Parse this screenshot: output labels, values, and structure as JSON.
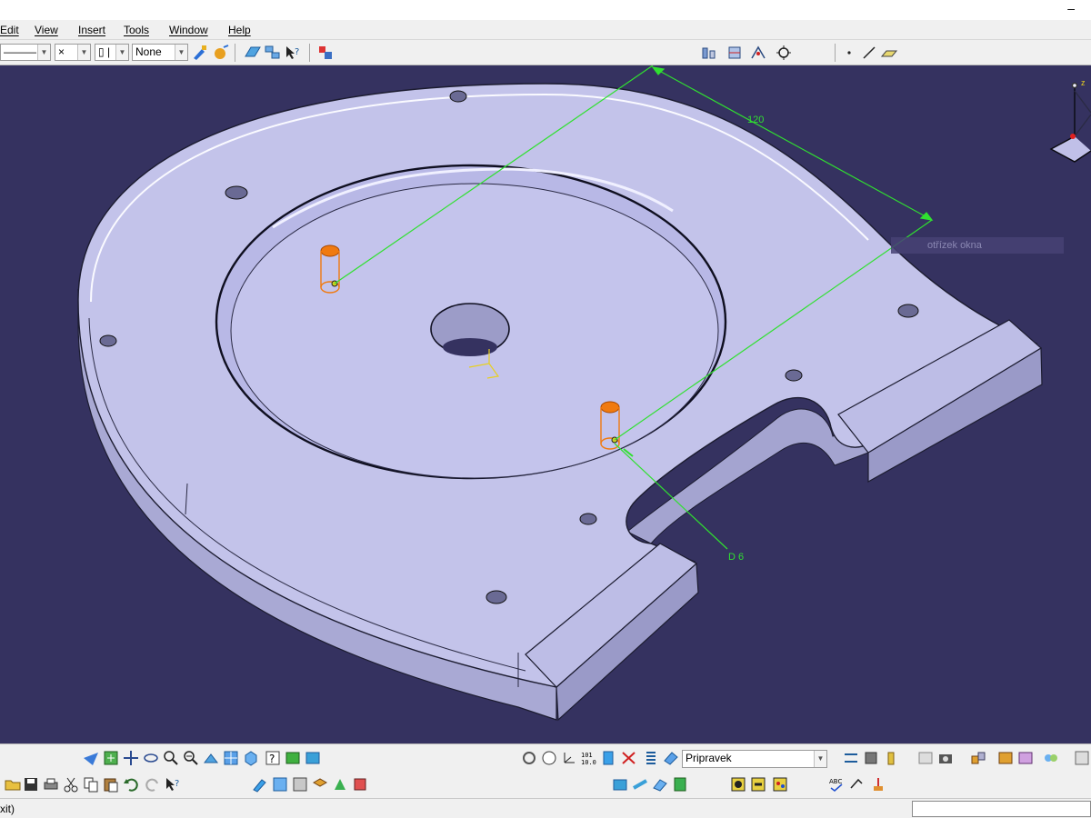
{
  "titlebar": {
    "minimize_glyph": "–"
  },
  "menu": [
    {
      "label": "Edit"
    },
    {
      "label": "View"
    },
    {
      "label": "Insert"
    },
    {
      "label": "Tools"
    },
    {
      "label": "Window"
    },
    {
      "label": "Help"
    }
  ],
  "toolbar_top": {
    "linetype_value": "———",
    "point_type_value": "×",
    "layer_value": "▯ |",
    "filter_value": "None"
  },
  "viewport": {
    "hint_text": "otřízek okna",
    "dimension_length": "120",
    "dimension_diameter": "D 6",
    "axis_label_z": "z"
  },
  "toolbar_bottom": {
    "current_body_value": "Pripravek"
  },
  "statusbar": {
    "message": "xit)"
  },
  "colors": {
    "background": "#353260",
    "part_face": "#c3c3ea",
    "part_side": "#a9a9d4",
    "dimension": "#30e030",
    "pin": "#f07a10"
  }
}
